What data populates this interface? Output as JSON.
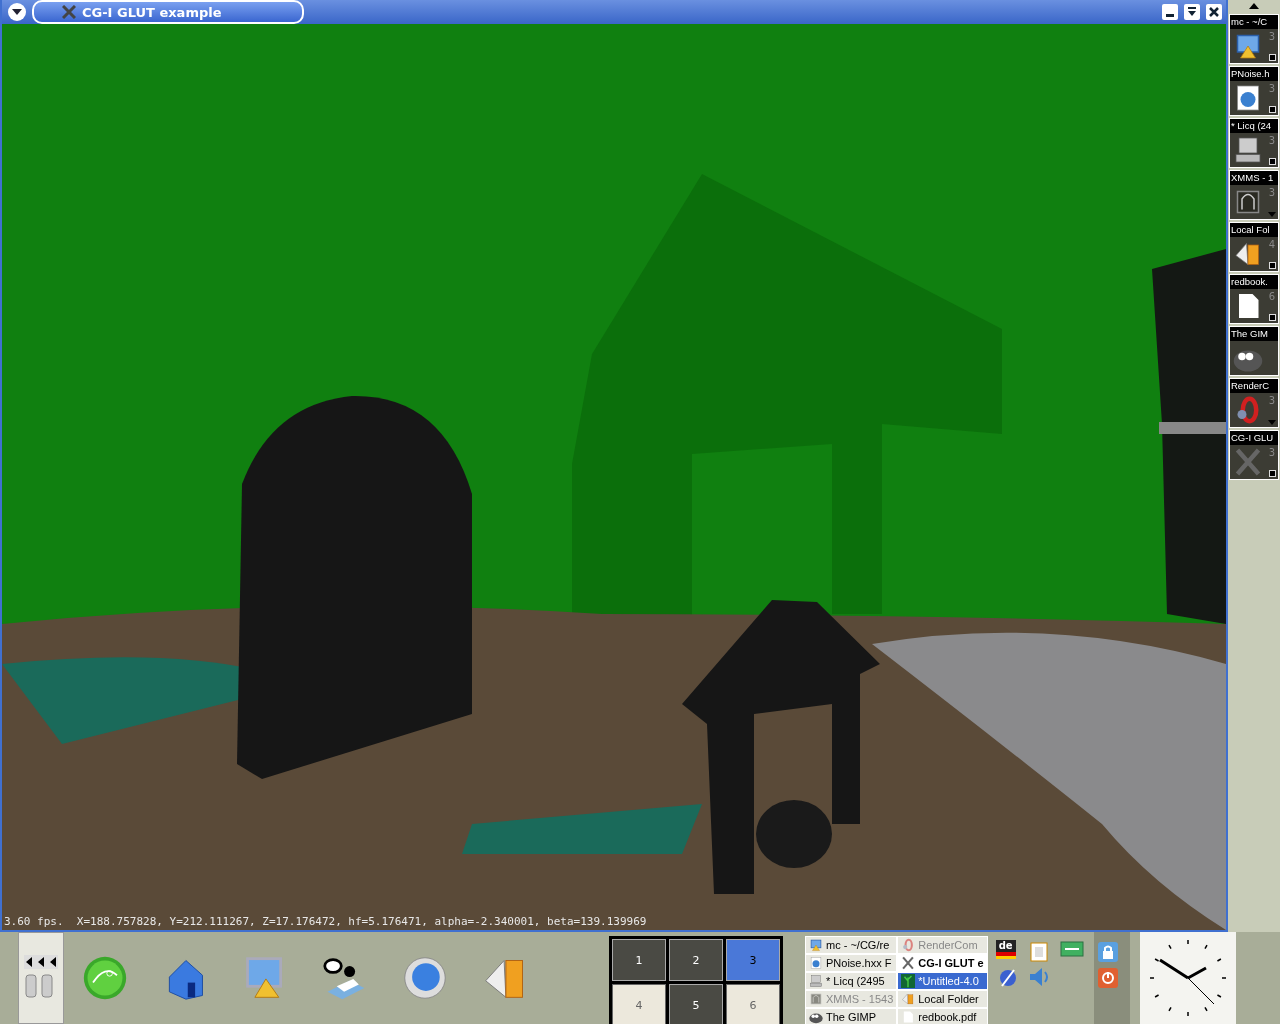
{
  "window": {
    "title": "CG-I GLUT example",
    "status_text": "3.60 fps.  X=188.757828, Y=212.111267, Z=17.176472, hf=5.176471, alpha=-2.340001, beta=139.139969"
  },
  "window_list": [
    {
      "title": "mc - ~/C",
      "desktop": "3",
      "kind": "square"
    },
    {
      "title": "PNoise.h",
      "desktop": "3",
      "kind": "square"
    },
    {
      "title": "* Licq (24",
      "desktop": "3",
      "kind": "square"
    },
    {
      "title": "XMMS - 1",
      "desktop": "3",
      "kind": "arrow"
    },
    {
      "title": "Local Fol",
      "desktop": "4",
      "kind": "square"
    },
    {
      "title": "redbook.",
      "desktop": "6",
      "kind": "square"
    },
    {
      "title": "The GIM",
      "kind": "plain"
    },
    {
      "title": "RenderC",
      "desktop": "3",
      "kind": "arrow"
    },
    {
      "title": "CG-I GLU",
      "desktop": "3",
      "kind": "square"
    }
  ],
  "pager": [
    {
      "label": "1",
      "selected": false,
      "occupied": true
    },
    {
      "label": "2",
      "selected": false,
      "occupied": true
    },
    {
      "label": "3",
      "selected": true,
      "occupied": true
    },
    {
      "label": "4",
      "selected": false,
      "occupied": false
    },
    {
      "label": "5",
      "selected": false,
      "occupied": true
    },
    {
      "label": "6",
      "selected": false,
      "occupied": false
    }
  ],
  "taskbar": [
    {
      "label": "mc - ~/CG/re",
      "minimized": false,
      "active": false,
      "selected": false
    },
    {
      "label": "PNoise.hxx F",
      "minimized": false,
      "active": false,
      "selected": false
    },
    {
      "label": "* Licq (2495",
      "minimized": false,
      "active": false,
      "selected": false
    },
    {
      "label": "XMMS - 1543",
      "minimized": true,
      "active": false,
      "selected": false
    },
    {
      "label": "The GIMP",
      "minimized": false,
      "active": false,
      "selected": false
    },
    {
      "label": "RenderCom",
      "minimized": true,
      "active": false,
      "selected": false
    },
    {
      "label": "CG-I GLUT e",
      "minimized": false,
      "active": true,
      "selected": false
    },
    {
      "label": "*Untitled-4.0",
      "minimized": false,
      "active": false,
      "selected": true
    },
    {
      "label": "Local Folder",
      "minimized": false,
      "active": false,
      "selected": false
    },
    {
      "label": "redbook.pdf",
      "minimized": false,
      "active": false,
      "selected": false
    }
  ],
  "tray": {
    "keyboard_layout": "de"
  }
}
